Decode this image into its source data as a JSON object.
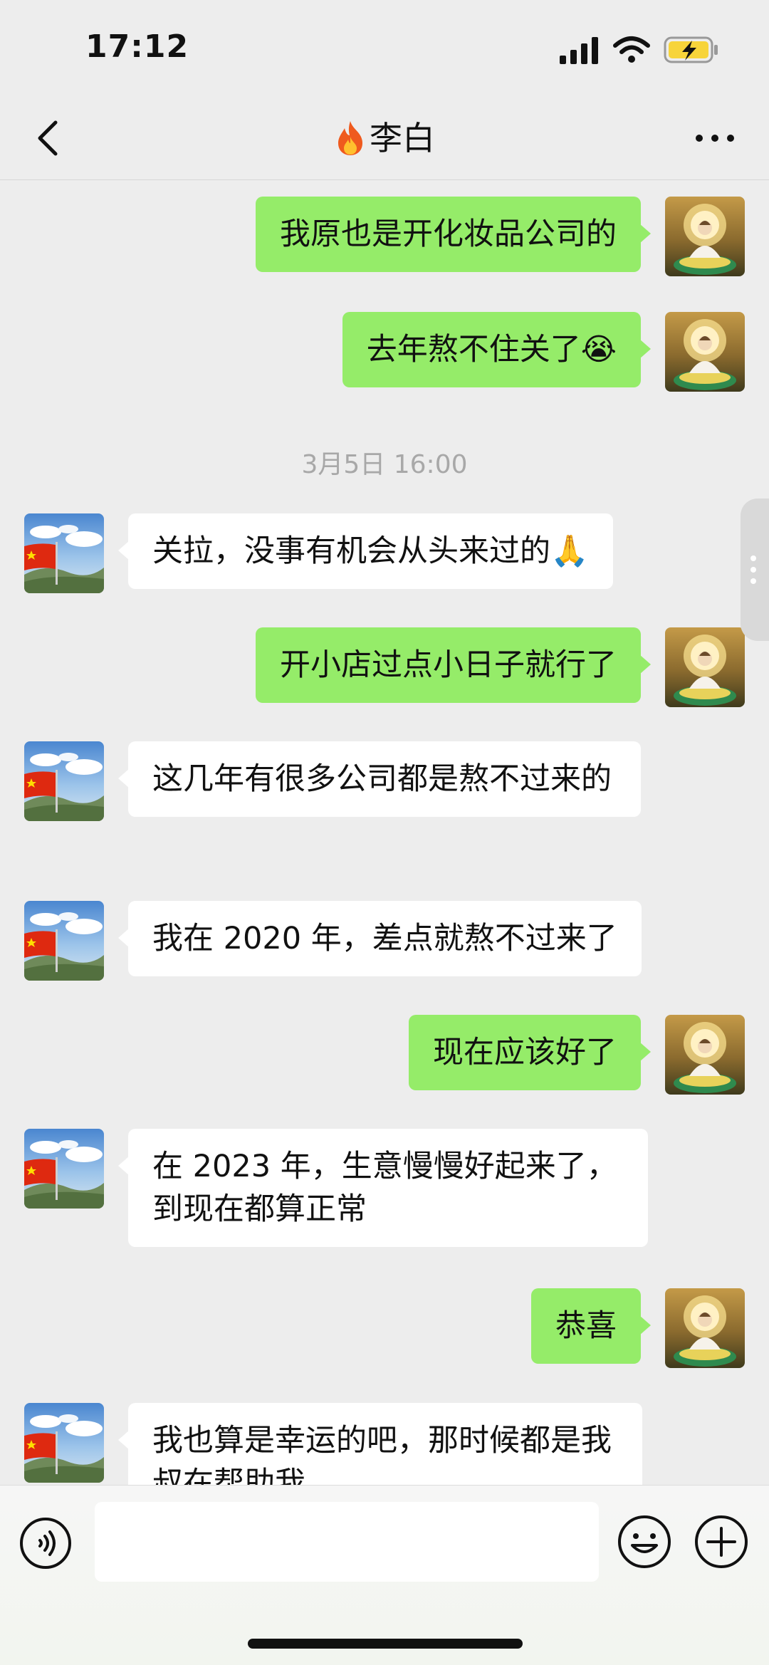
{
  "status": {
    "time": "17:12"
  },
  "nav": {
    "title": "李白",
    "title_icon": "fire-emoji"
  },
  "messages": [
    {
      "side": "me",
      "text": "我原也是开化妆品公司的"
    },
    {
      "side": "me",
      "text": "去年熬不住关了😭"
    },
    {
      "type": "timestamp",
      "text": "3月5日 16:00"
    },
    {
      "side": "them",
      "text": "关拉，没事有机会从头来过的🙏"
    },
    {
      "side": "me",
      "text": "开小店过点小日子就行了"
    },
    {
      "side": "them",
      "text": "这几年有很多公司都是熬不过来的"
    },
    {
      "side": "them",
      "text": "我在 2020 年，差点就熬不过来了"
    },
    {
      "side": "me",
      "text": "现在应该好了"
    },
    {
      "side": "them",
      "text": "在 2023 年，生意慢慢好起来了，到现在都算正常"
    },
    {
      "side": "me",
      "text": "恭喜"
    },
    {
      "side": "them",
      "text": "我也算是幸运的吧，那时候都是我叔在帮助我"
    }
  ],
  "input": {
    "value": "",
    "placeholder": ""
  },
  "colors": {
    "me_bubble": "#95ec69",
    "them_bubble": "#ffffff",
    "background": "#ededed"
  }
}
